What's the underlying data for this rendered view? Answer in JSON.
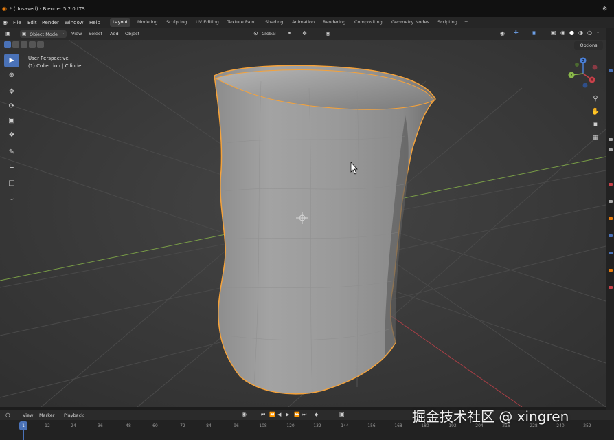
{
  "window": {
    "title": "* (Unsaved) - Blender 5.2.0 LTS"
  },
  "menu": {
    "items": [
      "File",
      "Edit",
      "Render",
      "Window",
      "Help"
    ],
    "workspaces": [
      "Layout",
      "Modeling",
      "Sculpting",
      "UV Editing",
      "Texture Paint",
      "Shading",
      "Animation",
      "Rendering",
      "Compositing",
      "Geometry Nodes",
      "Scripting"
    ],
    "active_workspace": "Layout",
    "add_tab": "+"
  },
  "header": {
    "mode": "Object Mode",
    "items": [
      "View",
      "Select",
      "Add",
      "Object"
    ],
    "orientation": "Global",
    "options_label": "Options"
  },
  "viewport": {
    "view_name": "User Perspective",
    "collection_info": "(1) Collection | Cilinder",
    "gizmo_axes": {
      "z": "Z",
      "y": "Y",
      "x": "X"
    },
    "colors": {
      "grid_bg": "#3d3d3d",
      "selection_outline": "#f5a23a",
      "axis_x": "#c8414a",
      "axis_y": "#8ab84a"
    }
  },
  "toolbar": {
    "tools": [
      "select-box-icon",
      "cursor-icon",
      "move-icon",
      "rotate-icon",
      "scale-icon",
      "transform-icon",
      "annotate-icon",
      "measure-icon",
      "add-cube-icon",
      "curve-icon"
    ],
    "active_tool": "select-box-icon"
  },
  "navigation": [
    "zoom-icon",
    "pan-hand-icon",
    "camera-icon",
    "grid-toggle-icon"
  ],
  "timeline": {
    "items": [
      "View",
      "Marker",
      "Playback"
    ],
    "current_frame": "1",
    "frames": [
      "1",
      "12",
      "24",
      "36",
      "48",
      "60",
      "72",
      "84",
      "96",
      "108",
      "120",
      "132",
      "144",
      "156",
      "168",
      "180",
      "192",
      "204",
      "216",
      "228",
      "240",
      "252"
    ],
    "colors": {
      "playhead": "#4a72b8"
    }
  },
  "watermark": "掘金技术社区 @ xingren"
}
